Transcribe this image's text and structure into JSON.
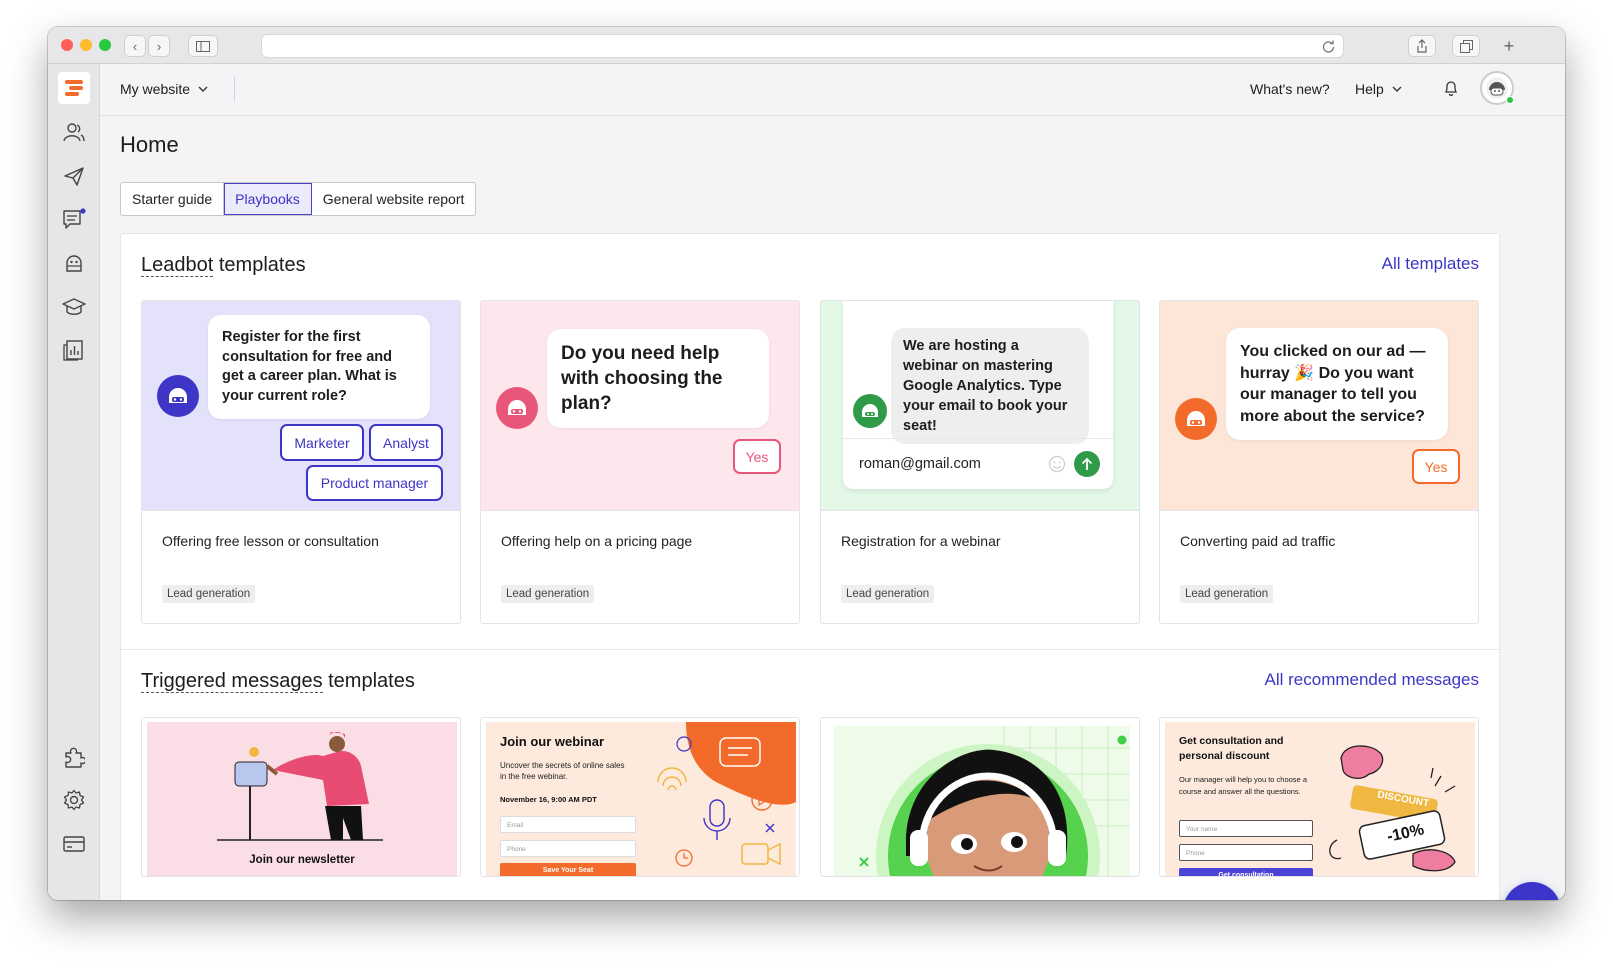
{
  "topbar": {
    "site_selector": "My website",
    "whats_new": "What's new?",
    "help": "Help"
  },
  "page": {
    "title": "Home",
    "tabs": [
      "Starter guide",
      "Playbooks",
      "General website report"
    ],
    "active_tab": "Playbooks"
  },
  "leadbot": {
    "title_underlined": "Leadbot",
    "title_rest": " templates",
    "link": "All templates",
    "cards": [
      {
        "bubble": "Register for the first consultation for free and get a career plan. What is your current role?",
        "options": [
          "Marketer",
          "Analyst",
          "Product manager"
        ],
        "name": "Offering free lesson or consultation",
        "tag": "Lead generation",
        "bg": "#e4e2fb"
      },
      {
        "bubble": "Do you need help with choosing the plan?",
        "options": [
          "Yes"
        ],
        "name": "Offering help on a pricing page",
        "tag": "Lead generation",
        "bg": "#fde7ec"
      },
      {
        "bubble": "We are hosting a webinar on mastering Google Analytics. Type your email to book your seat!",
        "input_value": "roman@gmail.com",
        "name": "Registration for a webinar",
        "tag": "Lead generation",
        "bg": "#e3f8e6"
      },
      {
        "bubble": "You clicked on our ad — hurray 🎉 Do you want our manager to tell you more about the service?",
        "options": [
          "Yes"
        ],
        "name": "Converting paid ad traffic",
        "tag": "Lead generation",
        "bg": "#fde5d7"
      }
    ]
  },
  "triggered": {
    "title_underlined": "Triggered messages",
    "title_rest": " templates",
    "link": "All recommended messages",
    "newsletter": {
      "caption": "Join our newsletter"
    },
    "webinar": {
      "title": "Join our webinar",
      "desc": "Uncover the secrets of online sales in the free webinar.",
      "date": "November 16, 9:00 AM PDT",
      "email_placeholder": "Email",
      "phone_placeholder": "Phone",
      "button": "Save Your Seat"
    },
    "consultation": {
      "title": "Get consultation and personal discount",
      "desc": "Our manager will help you to choose a course and answer all the questions.",
      "name_placeholder": "Your name",
      "phone_placeholder": "Phone",
      "button": "Get consultation",
      "discount": "DISCOUNT",
      "percent": "-10%"
    }
  },
  "colors": {
    "accent": "#3d35c5",
    "brand": "#f26b2a"
  }
}
